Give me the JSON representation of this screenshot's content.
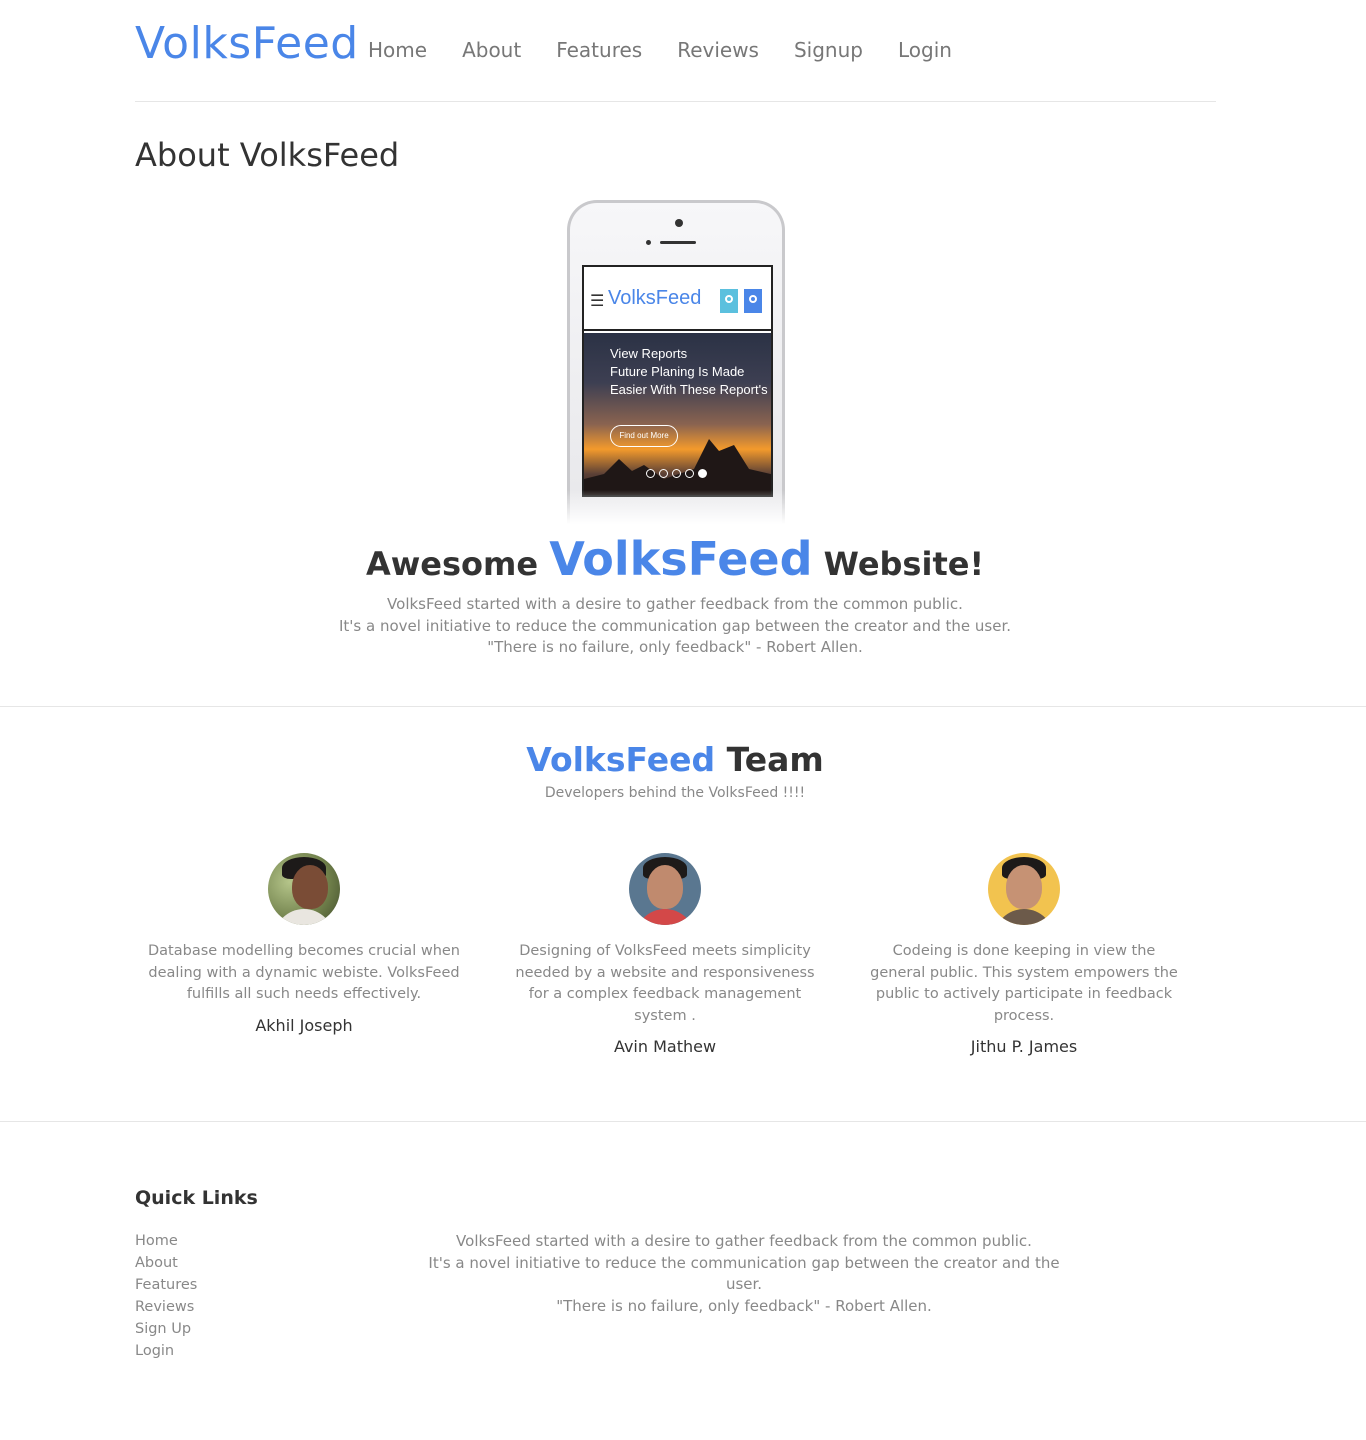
{
  "header": {
    "brand": "VolksFeed",
    "nav": [
      "Home",
      "About",
      "Features",
      "Reviews",
      "Signup",
      "Login"
    ]
  },
  "about": {
    "title": "About VolksFeed",
    "phone": {
      "brand": "VolksFeed",
      "hero_lines": [
        "View Reports",
        "Future Planing Is Made",
        "Easier With These Report's"
      ],
      "button": "Find out More"
    },
    "tagline_pre": "Awesome",
    "tagline_highlight": "VolksFeed",
    "tagline_post": "Website!",
    "desc": [
      "VolksFeed started with a desire to gather feedback from the common public.",
      "It's a novel initiative to reduce the communication gap between the creator and the user.",
      "\"There is no failure, only feedback\" - Robert Allen."
    ]
  },
  "team": {
    "title_highlight": "VolksFeed",
    "title_rest": "Team",
    "subtitle": "Developers behind the VolksFeed !!!!",
    "members": [
      {
        "text": "Database  modelling becomes crucial when dealing with a dynamic webiste. VolksFeed fulfills all such needs effectively.",
        "name": "Akhil Joseph"
      },
      {
        "text": "Designing of VolksFeed meets simplicity needed by a website and responsiveness for a complex feedback management system .",
        "name": "Avin Mathew"
      },
      {
        "text": "Codeing is done keeping in view the general public. This system empowers the public to actively participate in feedback process.",
        "name": "Jithu P. James"
      }
    ]
  },
  "footer": {
    "quick_links_title": "Quick Links",
    "links": [
      "Home",
      "About",
      "Features",
      "Reviews",
      "Sign Up",
      "Login"
    ],
    "desc": [
      "VolksFeed started with a desire to gather feedback from the common public.",
      "It's a novel initiative to reduce the communication gap between the creator and the user.",
      "\"There is no failure, only feedback\" - Robert Allen."
    ]
  },
  "colors": {
    "accent": "#4a86e8",
    "text": "#333333",
    "muted": "#888888"
  }
}
